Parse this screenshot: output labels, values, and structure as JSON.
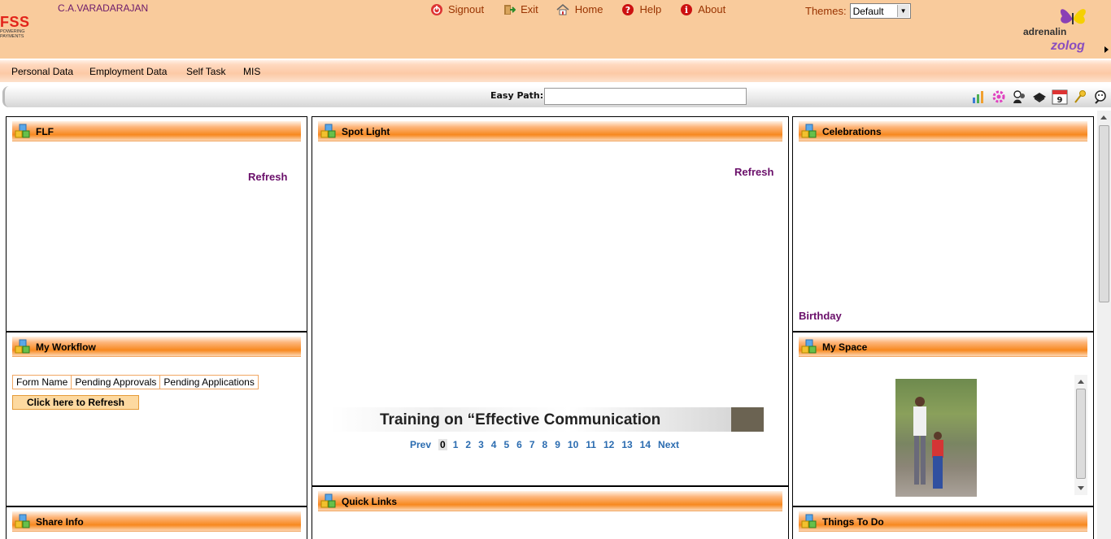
{
  "header": {
    "logo_main": "FSS",
    "logo_tagline_1": "POWERING",
    "logo_tagline_2": "PAYMENTS",
    "user_name": "C.A.VARADARAJAN",
    "nav": [
      {
        "label": "Signout",
        "icon": "power-icon"
      },
      {
        "label": "Exit",
        "icon": "exit-door-icon"
      },
      {
        "label": "Home",
        "icon": "home-icon"
      },
      {
        "label": "Help",
        "icon": "help-icon"
      },
      {
        "label": "About",
        "icon": "info-icon"
      }
    ],
    "themes_label": "Themes:",
    "theme_selected": "Default",
    "brand_1": "adrenalin",
    "brand_2": "zolog"
  },
  "menu": [
    "Personal Data",
    "Employment Data",
    "Self Task",
    "MIS"
  ],
  "easy_path": {
    "label": "Easy Path:",
    "value": ""
  },
  "toolbar_icons": [
    "chart-icon",
    "settings-icon",
    "people-icon",
    "mail-icon",
    "calendar-icon",
    "key-icon",
    "user-search-icon"
  ],
  "calendar_day": "9",
  "panels": {
    "flf": {
      "title": "FLF",
      "refresh": "Refresh"
    },
    "spotlight": {
      "title": "Spot Light",
      "refresh": "Refresh",
      "banner_text": "Training on “Effective Communication",
      "pager": {
        "prev": "Prev",
        "next": "Next",
        "pages": [
          "0",
          "1",
          "2",
          "3",
          "4",
          "5",
          "6",
          "7",
          "8",
          "9",
          "10",
          "11",
          "12",
          "13",
          "14"
        ],
        "current": "0"
      }
    },
    "celebrations": {
      "title": "Celebrations",
      "birthday": "Birthday"
    },
    "workflow": {
      "title": "My Workflow",
      "columns": [
        "Form Name",
        "Pending Approvals",
        "Pending Applications"
      ],
      "refresh_button": "Click here to Refresh"
    },
    "myspace": {
      "title": "My Space"
    },
    "share_info": {
      "title": "Share Info"
    },
    "quick_links": {
      "title": "Quick Links"
    },
    "things_to_do": {
      "title": "Things To Do"
    }
  }
}
